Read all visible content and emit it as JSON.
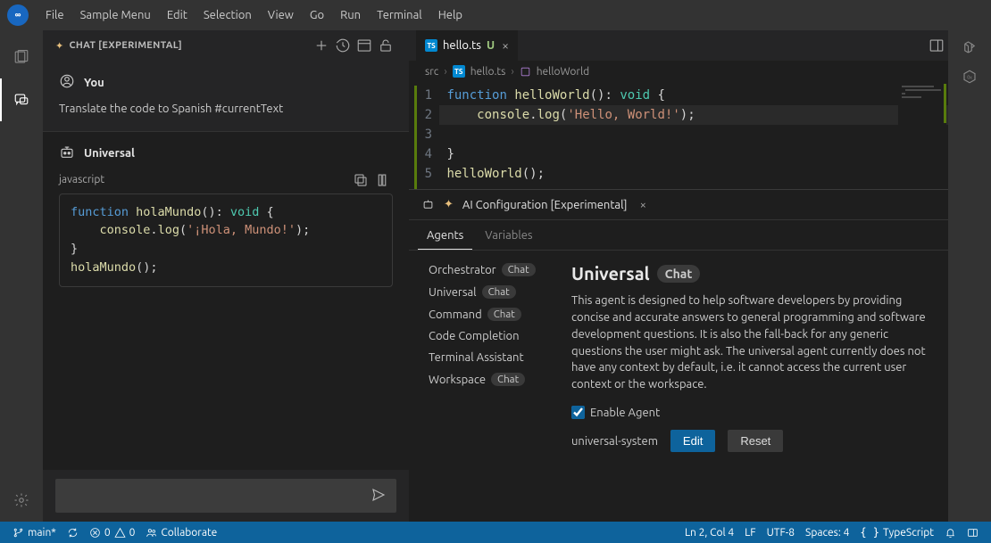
{
  "menubar": {
    "items": [
      "File",
      "Sample Menu",
      "Edit",
      "Selection",
      "View",
      "Go",
      "Run",
      "Terminal",
      "Help"
    ]
  },
  "sidebar": {
    "title": "CHAT [EXPERIMENTAL]",
    "user_name": "You",
    "user_msg": "Translate the code to Spanish #currentText",
    "assistant_name": "Universal",
    "code_lang": "javascript"
  },
  "editor": {
    "tab_name": "hello.ts",
    "tab_mod": "U",
    "breadcrumb_folder": "src",
    "breadcrumb_file": "hello.ts",
    "breadcrumb_symbol": "helloWorld"
  },
  "panel": {
    "title": "AI Configuration [Experimental]",
    "tabs": [
      "Agents",
      "Variables"
    ],
    "agents": [
      {
        "name": "Orchestrator",
        "badge": "Chat"
      },
      {
        "name": "Universal",
        "badge": "Chat"
      },
      {
        "name": "Command",
        "badge": "Chat"
      },
      {
        "name": "Code Completion",
        "badge": ""
      },
      {
        "name": "Terminal Assistant",
        "badge": ""
      },
      {
        "name": "Workspace",
        "badge": "Chat"
      }
    ],
    "detail_title": "Universal",
    "detail_badge": "Chat",
    "detail_desc": "This agent is designed to help software developers by providing concise and accurate answers to general programming and software development questions. It is also the fall-back for any generic questions the user might ask. The universal agent currently does not have any context by default, i.e. it cannot access the current user context or the workspace.",
    "enable_label": "Enable Agent",
    "system_label": "universal-system",
    "edit_btn": "Edit",
    "reset_btn": "Reset"
  },
  "status": {
    "branch": "main*",
    "errors": "0",
    "warnings": "0",
    "collab": "Collaborate",
    "ln": "Ln 2, Col 4",
    "lf": "LF",
    "enc": "UTF-8",
    "spaces": "Spaces: 4",
    "lang": "TypeScript"
  }
}
